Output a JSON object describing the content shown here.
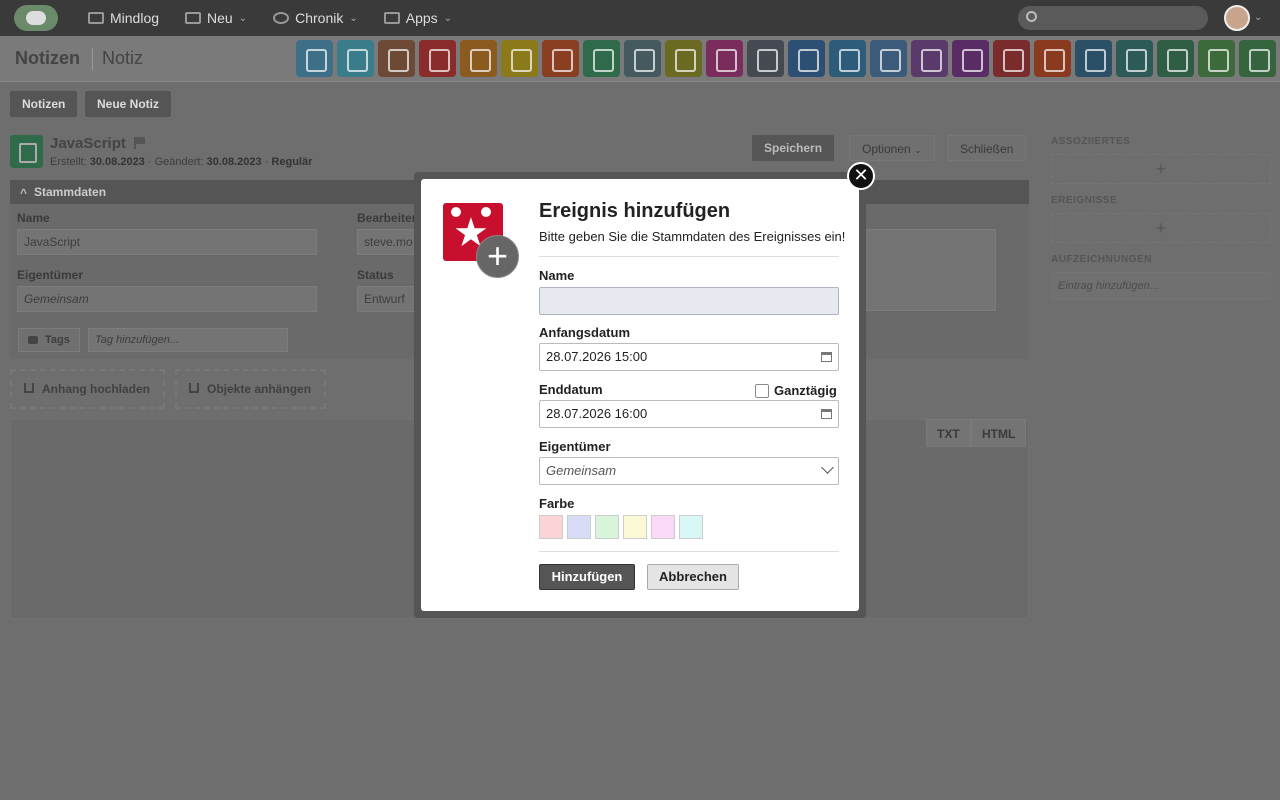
{
  "topbar": {
    "nav": [
      {
        "label": "Mindlog",
        "icon": "chat-icon",
        "chevron": false
      },
      {
        "label": "Neu",
        "icon": "sparkle-icon",
        "chevron": true
      },
      {
        "label": "Chronik",
        "icon": "history-icon",
        "chevron": true
      },
      {
        "label": "Apps",
        "icon": "grid-icon",
        "chevron": true
      }
    ],
    "search_placeholder": ""
  },
  "breadcrumb": {
    "main": "Notizen",
    "sub": "Notiz"
  },
  "app_icons": [
    {
      "name": "mail-app-icon",
      "color": "#3d6f88"
    },
    {
      "name": "email-app-icon",
      "color": "#3a7d8a"
    },
    {
      "name": "contacts-app-icon",
      "color": "#6d4a36"
    },
    {
      "name": "calendar-app-icon",
      "color": "#8a2c2c"
    },
    {
      "name": "timer-app-icon",
      "color": "#8a5a1e"
    },
    {
      "name": "tasks-app-icon",
      "color": "#8a7a1a"
    },
    {
      "name": "todo-app-icon",
      "color": "#8a3e22"
    },
    {
      "name": "notes-app-icon",
      "color": "#2f6a4a"
    },
    {
      "name": "bookmarks-app-icon",
      "color": "#445a5e"
    },
    {
      "name": "documents-app-icon",
      "color": "#6a6a22"
    },
    {
      "name": "register-app-icon",
      "color": "#7a2d5c"
    },
    {
      "name": "finance-app-icon",
      "color": "#454a52"
    },
    {
      "name": "shipping-app-icon",
      "color": "#2d4f73"
    },
    {
      "name": "support-app-icon",
      "color": "#2c5c7a"
    },
    {
      "name": "money-bag-app-icon",
      "color": "#3c5a7a"
    },
    {
      "name": "contracts-app-icon",
      "color": "#5a3a6a"
    },
    {
      "name": "deals-app-icon",
      "color": "#5a2c66"
    },
    {
      "name": "invoice-app-icon",
      "color": "#7a2c2c"
    },
    {
      "name": "broadcast-app-icon",
      "color": "#8a3a1e"
    },
    {
      "name": "download-app-icon",
      "color": "#2a4f66"
    },
    {
      "name": "shop-app-icon",
      "color": "#2c5a56"
    },
    {
      "name": "billing-app-icon",
      "color": "#2f5e44"
    },
    {
      "name": "tag-app-icon",
      "color": "#3d6a3a"
    },
    {
      "name": "database-app-icon",
      "color": "#35643f"
    }
  ],
  "toolbar": {
    "tab_notes": "Notizen",
    "tab_new": "Neue Notiz"
  },
  "record": {
    "title": "JavaScript",
    "created_label": "Erstellt:",
    "created": "30.08.2023",
    "changed_label": "Geändert:",
    "changed": "30.08.2023",
    "type": "Regulär",
    "save": "Speichern",
    "options": "Optionen",
    "close": "Schließen"
  },
  "stammdaten": {
    "header": "Stammdaten",
    "name_label": "Name",
    "name_value": "JavaScript",
    "editor_label": "Bearbeiter",
    "editor_value": "steve.mo",
    "owner_label": "Eigentümer",
    "owner_value": "Gemeinsam",
    "status_label": "Status",
    "status_value": "Entwurf",
    "tags_label": "Tags",
    "tags_placeholder": "Tag hinzufügen..."
  },
  "attachments": {
    "upload": "Anhang hochladen",
    "attach": "Objekte anhängen"
  },
  "editor": {
    "txt": "TXT",
    "html": "HTML"
  },
  "rightcol": {
    "associated": "ASSOZIIERTES",
    "events": "EREIGNISSE",
    "records": "AUFZEICHNUNGEN",
    "records_placeholder": "Eintrag hinzufügen...",
    "add": "+"
  },
  "modal": {
    "title": "Ereignis hinzufügen",
    "subtitle": "Bitte geben Sie die Stammdaten des Ereignisses ein!",
    "name_label": "Name",
    "name_value": "",
    "start_label": "Anfangsdatum",
    "start_value": "28.07.2026 15:00",
    "end_label": "Enddatum",
    "end_value": "28.07.2026 16:00",
    "allday_label": "Ganztägig",
    "owner_label": "Eigentümer",
    "owner_value": "Gemeinsam",
    "color_label": "Farbe",
    "colors": [
      "#fbd5d5",
      "#d9dcf7",
      "#d9f5d9",
      "#fbf8d5",
      "#f9d9f5",
      "#d9f7f7"
    ],
    "submit": "Hinzufügen",
    "cancel": "Abbrechen",
    "close_glyph": "✕",
    "plus_glyph": "+",
    "star_glyph": "★"
  }
}
